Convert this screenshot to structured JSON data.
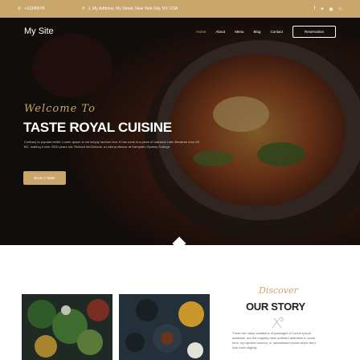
{
  "topbar": {
    "phone": "+12345678",
    "address": "1, My Address, My Street, New York City, NY, USA",
    "social_icons": [
      "facebook-icon",
      "twitter-icon",
      "instagram-icon",
      "pinterest-icon"
    ]
  },
  "nav": {
    "brand": "My Site",
    "items": [
      "Home",
      "About",
      "Menu",
      "Blog",
      "Contact"
    ],
    "active": "Home",
    "reservation_label": "Reservation"
  },
  "hero": {
    "welcome": "Welcome To",
    "title": "TASTE ROYAL CUISINE",
    "description": "Contrary to popular belief, Lorem Ipsum is not simply random text. It has roots in a piece of classical Latin literature from 45 BC, making it over 2000 years old. Richard McClintock, a Latin professor at Hampden-Sydney College.",
    "book_label": "Book A Table"
  },
  "story": {
    "kicker": "Discover",
    "title": "OUR STORY",
    "text": "There are many variations of passages of Lorem Ipsum available, but the majority have suffered alteration in some form, by injected humour, or randomised words which don't look even slightly"
  },
  "colors": {
    "accent": "#c9a66b",
    "hero_bg": "#1a1412"
  }
}
